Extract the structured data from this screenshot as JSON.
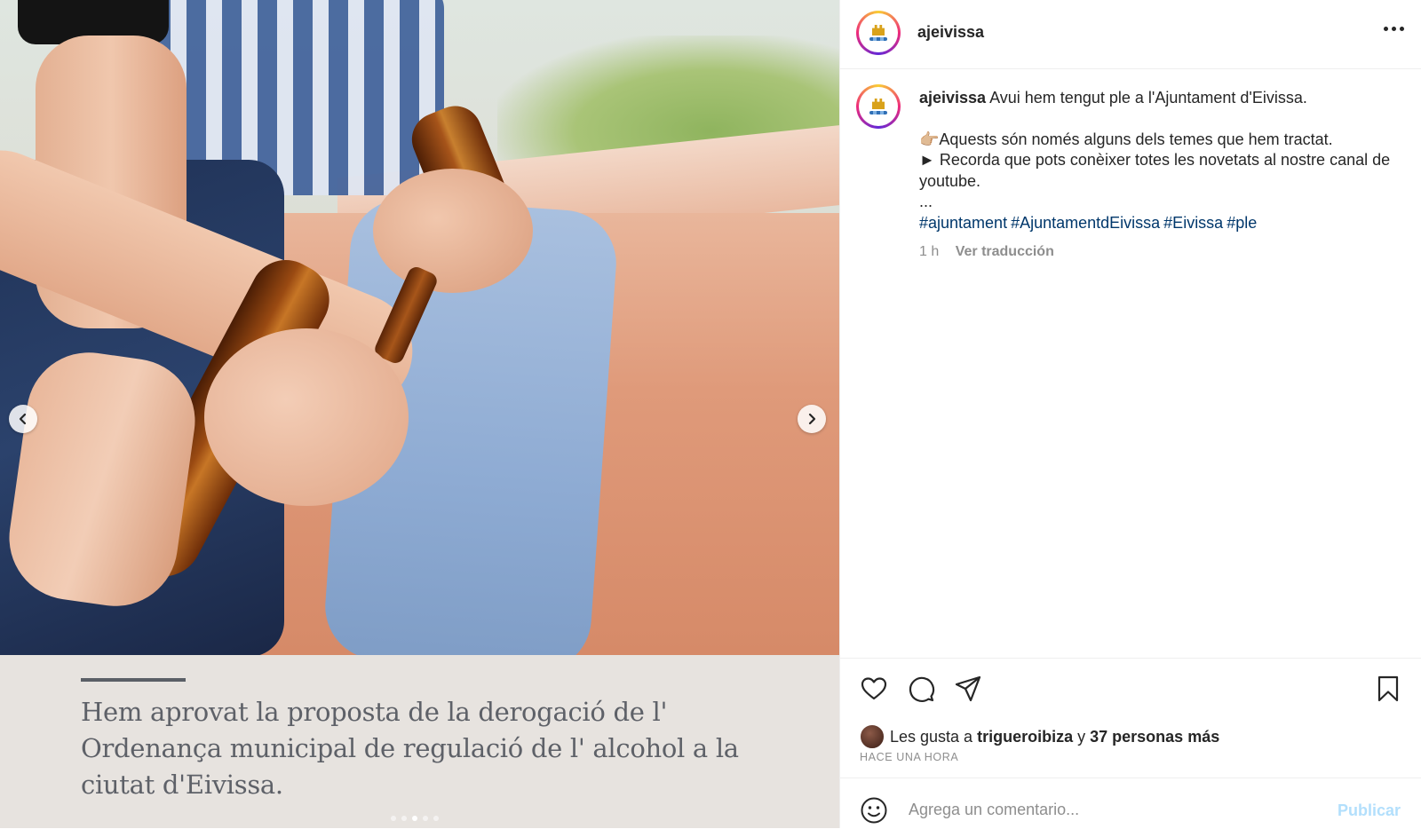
{
  "post": {
    "username": "ajeivissa",
    "caption": {
      "first_line": "Avui hem tengut ple a l'Ajuntament d'Eivissa.",
      "line2": "👉🏼Aquests són només alguns dels temes que hem tractat.",
      "line3": "► Recorda que pots conèixer totes les novetats al nostre canal de youtube.",
      "ellipsis": "...",
      "hashtags": [
        "#ajuntament",
        "#AjuntamentdEivissa",
        "#Eivissa",
        "#ple"
      ]
    },
    "time": "1 h",
    "translate_label": "Ver traducción",
    "likes": {
      "prefix": "Les gusta a",
      "user": "trigueroibiza",
      "connector": "y",
      "others": "37 personas más"
    },
    "time_ago": "HACE UNA HORA",
    "comment_placeholder": "Agrega un comentario...",
    "publish_label": "Publicar",
    "avatar_logo_text": "ajuntament d'eivissa"
  },
  "media": {
    "caption_text": "Hem aprovat la proposta de la derogació de l' Ordenança municipal de regulació de l' alcohol a la ciutat d'Eivissa.",
    "carousel_count": 5,
    "carousel_active_index": 2
  },
  "icons": [
    "more-icon",
    "chevron-left-icon",
    "chevron-right-icon",
    "heart-icon",
    "comment-icon",
    "share-icon",
    "bookmark-icon",
    "emoji-icon"
  ],
  "colors": {
    "link": "#00376b",
    "muted": "#8e8e8e",
    "publish_disabled": "#b2dffc",
    "caption_bg": "#e7e3df"
  }
}
